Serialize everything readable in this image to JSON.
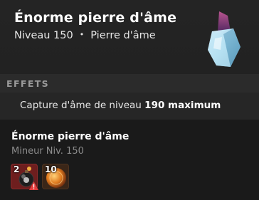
{
  "item": {
    "name": "Énorme pierre d'âme",
    "level_text": "Niveau 150",
    "separator": "•",
    "type": "Pierre d'âme",
    "icon": "soul-stone-crystal-icon"
  },
  "effects": {
    "section_label": "EFFETS",
    "line_prefix": "Capture d'âme de niveau",
    "line_value": "190 maximum"
  },
  "recipe": {
    "title": "Énorme pierre d'âme",
    "job": "Mineur Niv. 150",
    "ingredients": [
      {
        "quantity": "2",
        "icon": "bomb-ingredient-icon",
        "warning": true
      },
      {
        "quantity": "10",
        "icon": "orange-orb-ingredient-icon",
        "warning": false
      }
    ]
  },
  "colors": {
    "background": "#1a1a1a",
    "section_label": "#9a9a9a",
    "warning": "#e23b3b"
  }
}
